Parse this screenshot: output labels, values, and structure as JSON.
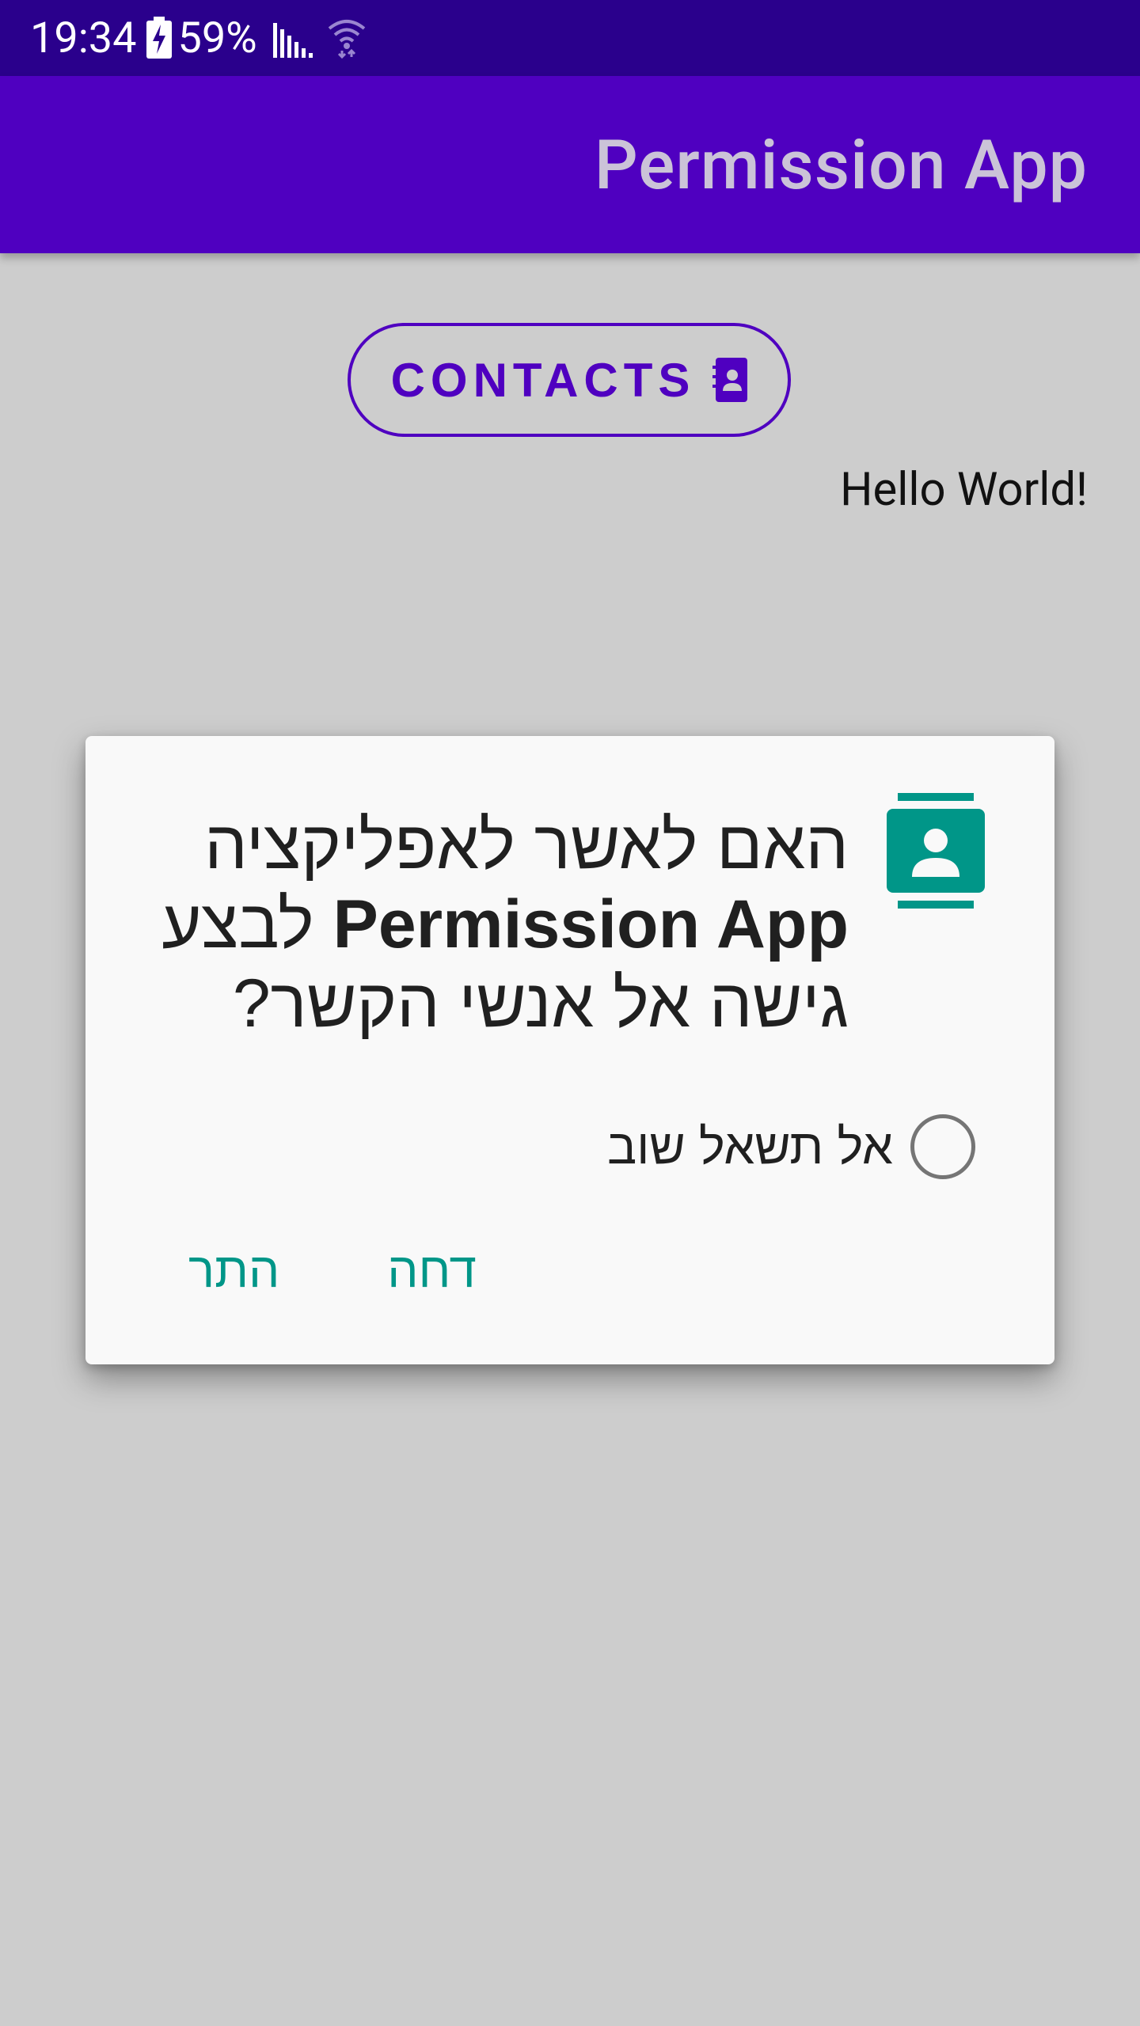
{
  "status_bar": {
    "time": "19:34",
    "battery_percent": "59%",
    "icons": [
      "battery-charging-icon",
      "signal-icon",
      "wifi-icon"
    ]
  },
  "app_bar": {
    "title": "Permission App"
  },
  "main": {
    "contacts_button_label": "CONTACTS",
    "contacts_button_icon": "contacts-book-icon",
    "hello_text": "Hello World!"
  },
  "dialog": {
    "icon": "contact-card-icon",
    "message_part1": "האם לאשר לאפליקציה ",
    "app_name": "Permission App",
    "message_part2": " לבצע גישה אל אנשי הקשר?",
    "dont_ask_label": "אל תשאל שוב",
    "deny_label": "דחה",
    "allow_label": "התר"
  },
  "colors": {
    "status_bar": "#2a008c",
    "primary": "#4f00c0",
    "background": "#cdcdcd",
    "dialog_accent": "#009688"
  }
}
